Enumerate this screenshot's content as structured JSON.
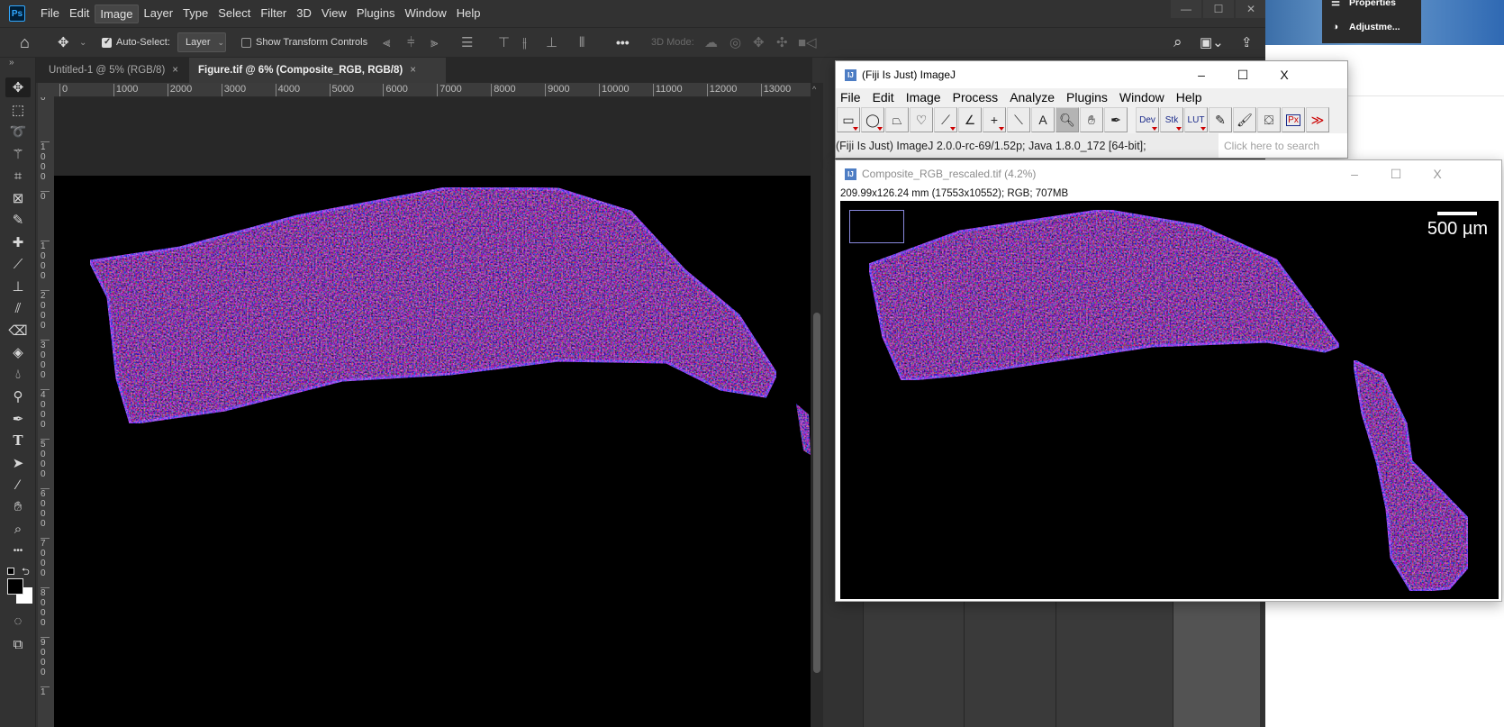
{
  "photoshop": {
    "logo": "Ps",
    "menu": [
      "File",
      "Edit",
      "Image",
      "Layer",
      "Type",
      "Select",
      "Filter",
      "3D",
      "View",
      "Plugins",
      "Window",
      "Help"
    ],
    "active_menu": "Image",
    "window_controls": {
      "minimize": "—",
      "maximize": "☐",
      "close": "✕"
    },
    "options": {
      "auto_select_label": "Auto-Select:",
      "auto_select_checked": true,
      "layer_dropdown": "Layer",
      "show_transform_label": "Show Transform Controls",
      "show_transform_checked": false,
      "more": "•••",
      "mode_3d_label": "3D Mode:"
    },
    "collapse_glyph": "»",
    "tabs": [
      {
        "label": "Untitled-1 @ 5% (RGB/8)",
        "close": "×",
        "active": false
      },
      {
        "label": "Figure.tif @ 6% (Composite_RGB, RGB/8)",
        "close": "×",
        "active": true
      }
    ],
    "ruler_h": [
      "0",
      "1000",
      "2000",
      "3000",
      "4000",
      "5000",
      "6000",
      "7000",
      "8000",
      "9000",
      "10000",
      "11000",
      "12000",
      "13000"
    ],
    "ruler_v": [
      "0",
      "1000",
      "0",
      "1000",
      "2000",
      "3000",
      "4000",
      "5000",
      "6000",
      "7000",
      "8000",
      "9000",
      "1"
    ],
    "tools": [
      "move",
      "rectangular-marquee",
      "lasso",
      "magic-wand",
      "crop",
      "frame",
      "eyedropper",
      "healing-brush",
      "brush",
      "clone-stamp",
      "history-brush",
      "eraser",
      "paint-bucket",
      "blur",
      "dodge",
      "pen",
      "type",
      "path-selection",
      "line",
      "hand",
      "zoom",
      "more-tools"
    ],
    "foreground_color": "#000000",
    "background_color": "#ffffff"
  },
  "desktop_popup": {
    "items": [
      {
        "icon": "sliders-icon",
        "label": "Properties"
      },
      {
        "icon": "adjustments-icon",
        "label": "Adjustme..."
      }
    ]
  },
  "imagej": {
    "title": "(Fiji Is Just) ImageJ",
    "icon": "IJ",
    "window_controls": {
      "minimize": "–",
      "maximize": "☐",
      "close": "X"
    },
    "menu": [
      "File",
      "Edit",
      "Image",
      "Process",
      "Analyze",
      "Plugins",
      "Window",
      "Help"
    ],
    "tools": [
      {
        "name": "rectangle",
        "glyph": "▭",
        "tri": true
      },
      {
        "name": "oval",
        "glyph": "◯",
        "tri": true
      },
      {
        "name": "polygon",
        "glyph": "⏢",
        "tri": false
      },
      {
        "name": "freehand",
        "glyph": "♡",
        "tri": false
      },
      {
        "name": "line",
        "glyph": "⟋",
        "tri": true
      },
      {
        "name": "angle",
        "glyph": "∠",
        "tri": false
      },
      {
        "name": "point",
        "glyph": "+",
        "tri": true
      },
      {
        "name": "wand",
        "glyph": "⟍",
        "tri": false
      },
      {
        "name": "text",
        "glyph": "A",
        "tri": false
      },
      {
        "name": "magnifier",
        "glyph": "🔍︎",
        "tri": false,
        "selected": true
      },
      {
        "name": "hand",
        "glyph": "✋︎",
        "tri": false
      },
      {
        "name": "color-picker",
        "glyph": "✒",
        "tri": false
      },
      {
        "name": "dev",
        "glyph": "Dev",
        "tri": true,
        "text": true,
        "gap": true
      },
      {
        "name": "stk",
        "glyph": "Stk",
        "tri": true,
        "text": true
      },
      {
        "name": "lut",
        "glyph": "LUT",
        "tri": true,
        "text": true
      },
      {
        "name": "pencil",
        "glyph": "✎",
        "tri": false
      },
      {
        "name": "brush",
        "glyph": "🖌︎",
        "tri": false
      },
      {
        "name": "flood-fill",
        "glyph": "⛋",
        "tri": false
      },
      {
        "name": "pixel-inspector",
        "glyph": "Px",
        "tri": false,
        "text": true
      },
      {
        "name": "more",
        "glyph": "≫",
        "tri": false
      }
    ],
    "status": "(Fiji Is Just) ImageJ 2.0.0-rc-69/1.52p; Java 1.8.0_172 [64-bit];",
    "search_placeholder": "Click here to search"
  },
  "image_window": {
    "title": "Composite_RGB_rescaled.tif (4.2%)",
    "info": "209.99x126.24 mm (17553x10552); RGB; 707MB",
    "scale_bar_label": "500 µm",
    "window_controls": {
      "minimize": "–",
      "maximize": "☐",
      "close": "X"
    }
  }
}
